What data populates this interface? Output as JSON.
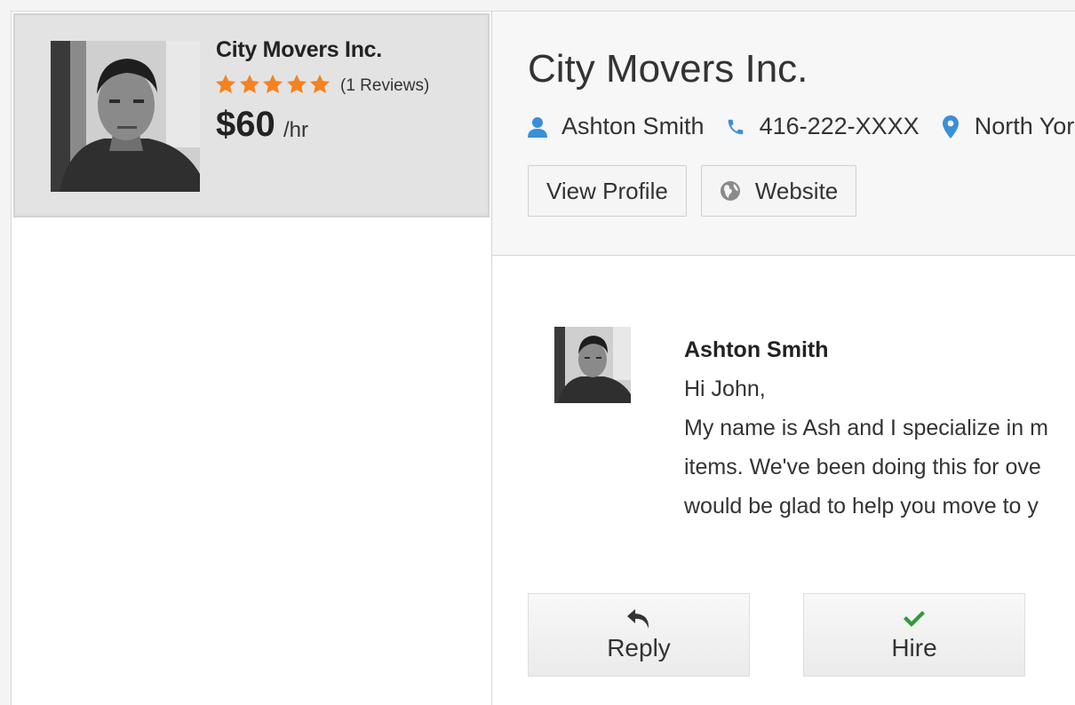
{
  "colors": {
    "accent_blue": "#3a8fd9",
    "star_orange": "#f58220",
    "hire_green": "#2e9b3f",
    "card_bg": "#e3e3e3"
  },
  "sidebar": {
    "card": {
      "company": "City Movers Inc.",
      "rating": 5,
      "rating_max": 5,
      "reviews": "(1 Reviews)",
      "price": "$60",
      "price_unit": "/hr"
    }
  },
  "header": {
    "title": "City Movers Inc.",
    "contact_name": "Ashton Smith",
    "phone": "416-222-XXXX",
    "location": "North York",
    "view_profile_label": "View Profile",
    "website_label": "Website",
    "icons": {
      "person": "person-icon",
      "phone": "phone-icon",
      "location": "location-pin-icon",
      "globe": "globe-icon"
    }
  },
  "message": {
    "author": "Ashton Smith",
    "lines": [
      "Hi John,",
      "My name is Ash and I specialize in m",
      "items. We've been doing this for ove",
      "would be glad to help you move to y"
    ]
  },
  "actions": {
    "reply_label": "Reply",
    "hire_label": "Hire",
    "icons": {
      "reply": "reply-arrow-icon",
      "hire": "checkmark-icon"
    }
  }
}
